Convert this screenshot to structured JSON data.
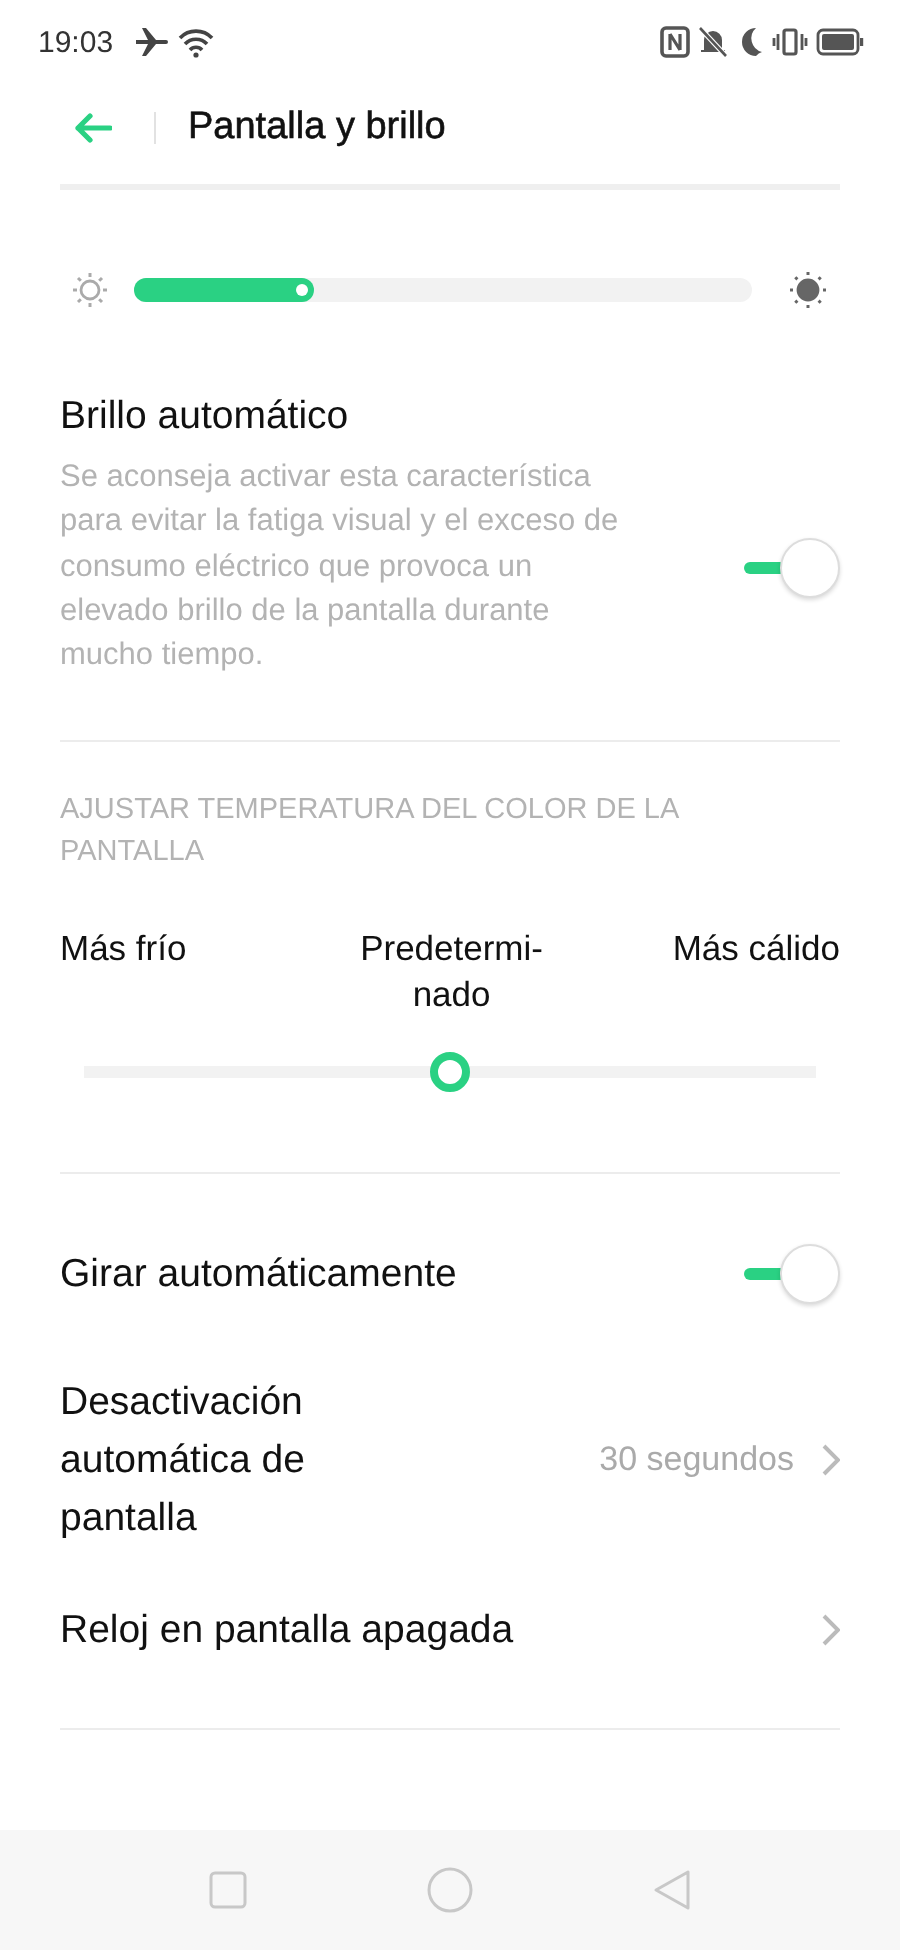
{
  "status_bar": {
    "time": "19:03"
  },
  "header": {
    "title": "Pantalla y brillo"
  },
  "brightness": {
    "level": 0.29
  },
  "auto_brightness": {
    "title": "Brillo automático",
    "description": "Se aconseja activar esta característica para evitar la fatiga visual y el exceso de consumo eléctrico que provoca un elevado brillo de la pantalla durante mucho tiempo.",
    "on": true
  },
  "color_temperature": {
    "heading": "AJUSTAR TEMPERATURA DEL COLOR DE LA PANTALLA",
    "labels": [
      "Más frío",
      "Predetermi-nado",
      "Más cálido"
    ],
    "level": 0.5
  },
  "settings": [
    {
      "kind": "toggle",
      "label": "Girar automáticamente",
      "on": true
    },
    {
      "kind": "link",
      "label": "Desactivación automática de pantalla",
      "value": "30 segundos"
    },
    {
      "kind": "link",
      "label": "Reloj en pantalla apagada"
    }
  ]
}
